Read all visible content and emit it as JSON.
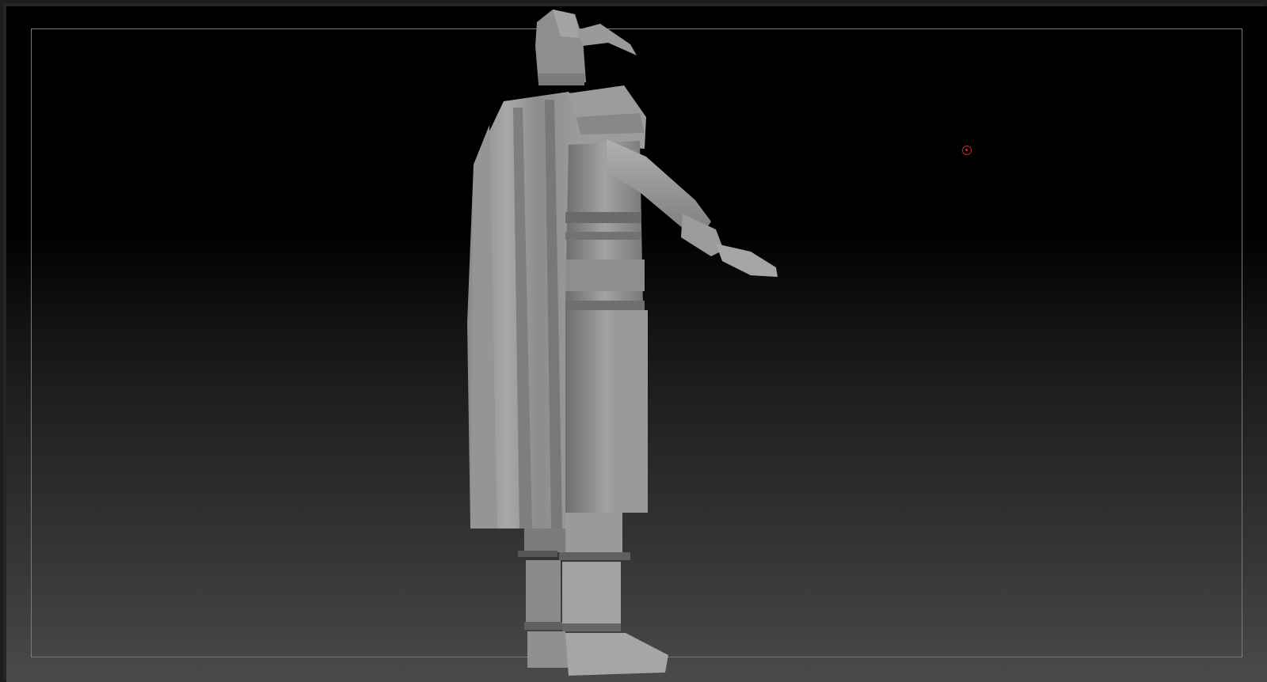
{
  "app": {
    "name": "",
    "accent": "#c42a2a"
  },
  "viewport": {
    "background_top": "#000000",
    "background_bottom": "#4a4a4a",
    "frame_color": "#7a7a7a"
  },
  "scene": {
    "model_icon": "armored-knight-sculpt",
    "model_material": "#8f8f8f"
  },
  "cursor": {
    "icon": "brush-cursor-icon",
    "color": "#c42a2a"
  }
}
